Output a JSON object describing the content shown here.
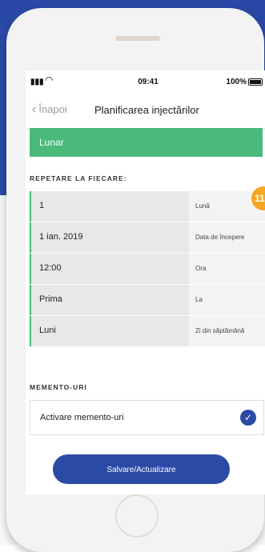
{
  "status_bar": {
    "time": "09:41",
    "battery": "100%"
  },
  "navbar": {
    "back_label": "Înapoi",
    "title": "Planificarea injectărilor"
  },
  "selected_frequency": "Lunar",
  "repeat_section": {
    "heading": "REPETARE LA FIECARE:",
    "rows": [
      {
        "value": "1",
        "label": "Lună"
      },
      {
        "value": "1 ian. 2019",
        "label": "Data de începere"
      },
      {
        "value": "12:00",
        "label": "Ora"
      },
      {
        "value": "Prima",
        "label": "La"
      },
      {
        "value": "Luni",
        "label": "Zi din săptămână"
      }
    ]
  },
  "reminders_section": {
    "heading": "MEMENTO-URI",
    "toggle_label": "Activare memento-uri",
    "checked": true
  },
  "save_button": "Salvare/Actualizare",
  "page_badge": "11",
  "colors": {
    "accent_green": "#4aba7b",
    "accent_blue": "#2b4aa6",
    "badge_orange": "#f5a623"
  }
}
